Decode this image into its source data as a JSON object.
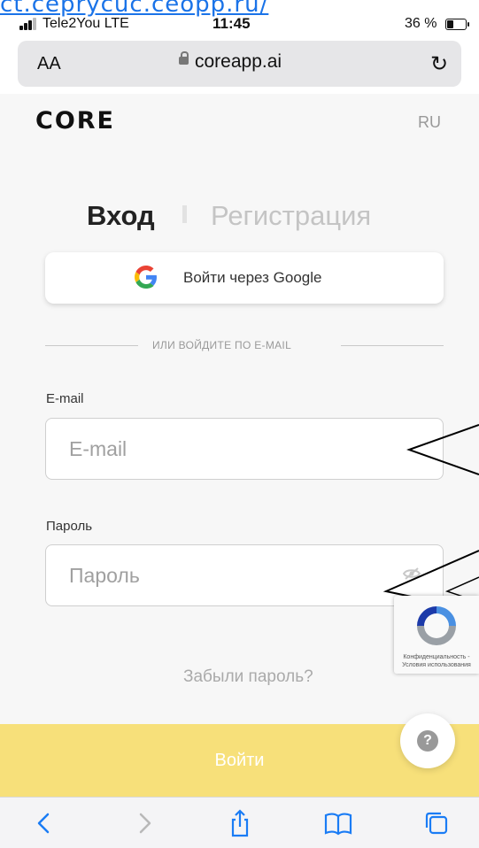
{
  "top_link": {
    "text": "ct.ceprycuc.ceopp.ru/"
  },
  "status_bar": {
    "carrier": "Tele2You  LTE",
    "time": "11:45",
    "battery_percent": "36 %",
    "battery_level": 0.36
  },
  "address_bar": {
    "text_size_label": "AA",
    "url": "coreapp.ai",
    "icons": [
      "lock-icon",
      "reload-icon"
    ]
  },
  "header": {
    "logo": "CORE",
    "language": "RU"
  },
  "auth_tabs": {
    "login": "Вход",
    "register": "Регистрация"
  },
  "google_button": {
    "icon_letter": "G",
    "label": "Войти через Google"
  },
  "divider_text": "ИЛИ ВОЙДИТЕ ПО E-MAIL",
  "email": {
    "label": "E-mail",
    "value": "",
    "placeholder": "E-mail"
  },
  "password": {
    "label": "Пароль",
    "value": "",
    "placeholder": "Пароль"
  },
  "forgot_link": "Забыли пароль?",
  "login_button": "Войти",
  "help_button": "?",
  "recaptcha": {
    "text": "Конфиденциальность - Условия использования"
  },
  "colors": {
    "accent_yellow": "#f7e07a",
    "link_blue": "#1a73e8",
    "toolbar_blue": "#1a7cf5"
  },
  "toolbar_icons": [
    "back-icon",
    "forward-icon",
    "share-icon",
    "bookmarks-icon",
    "tabs-icon"
  ]
}
